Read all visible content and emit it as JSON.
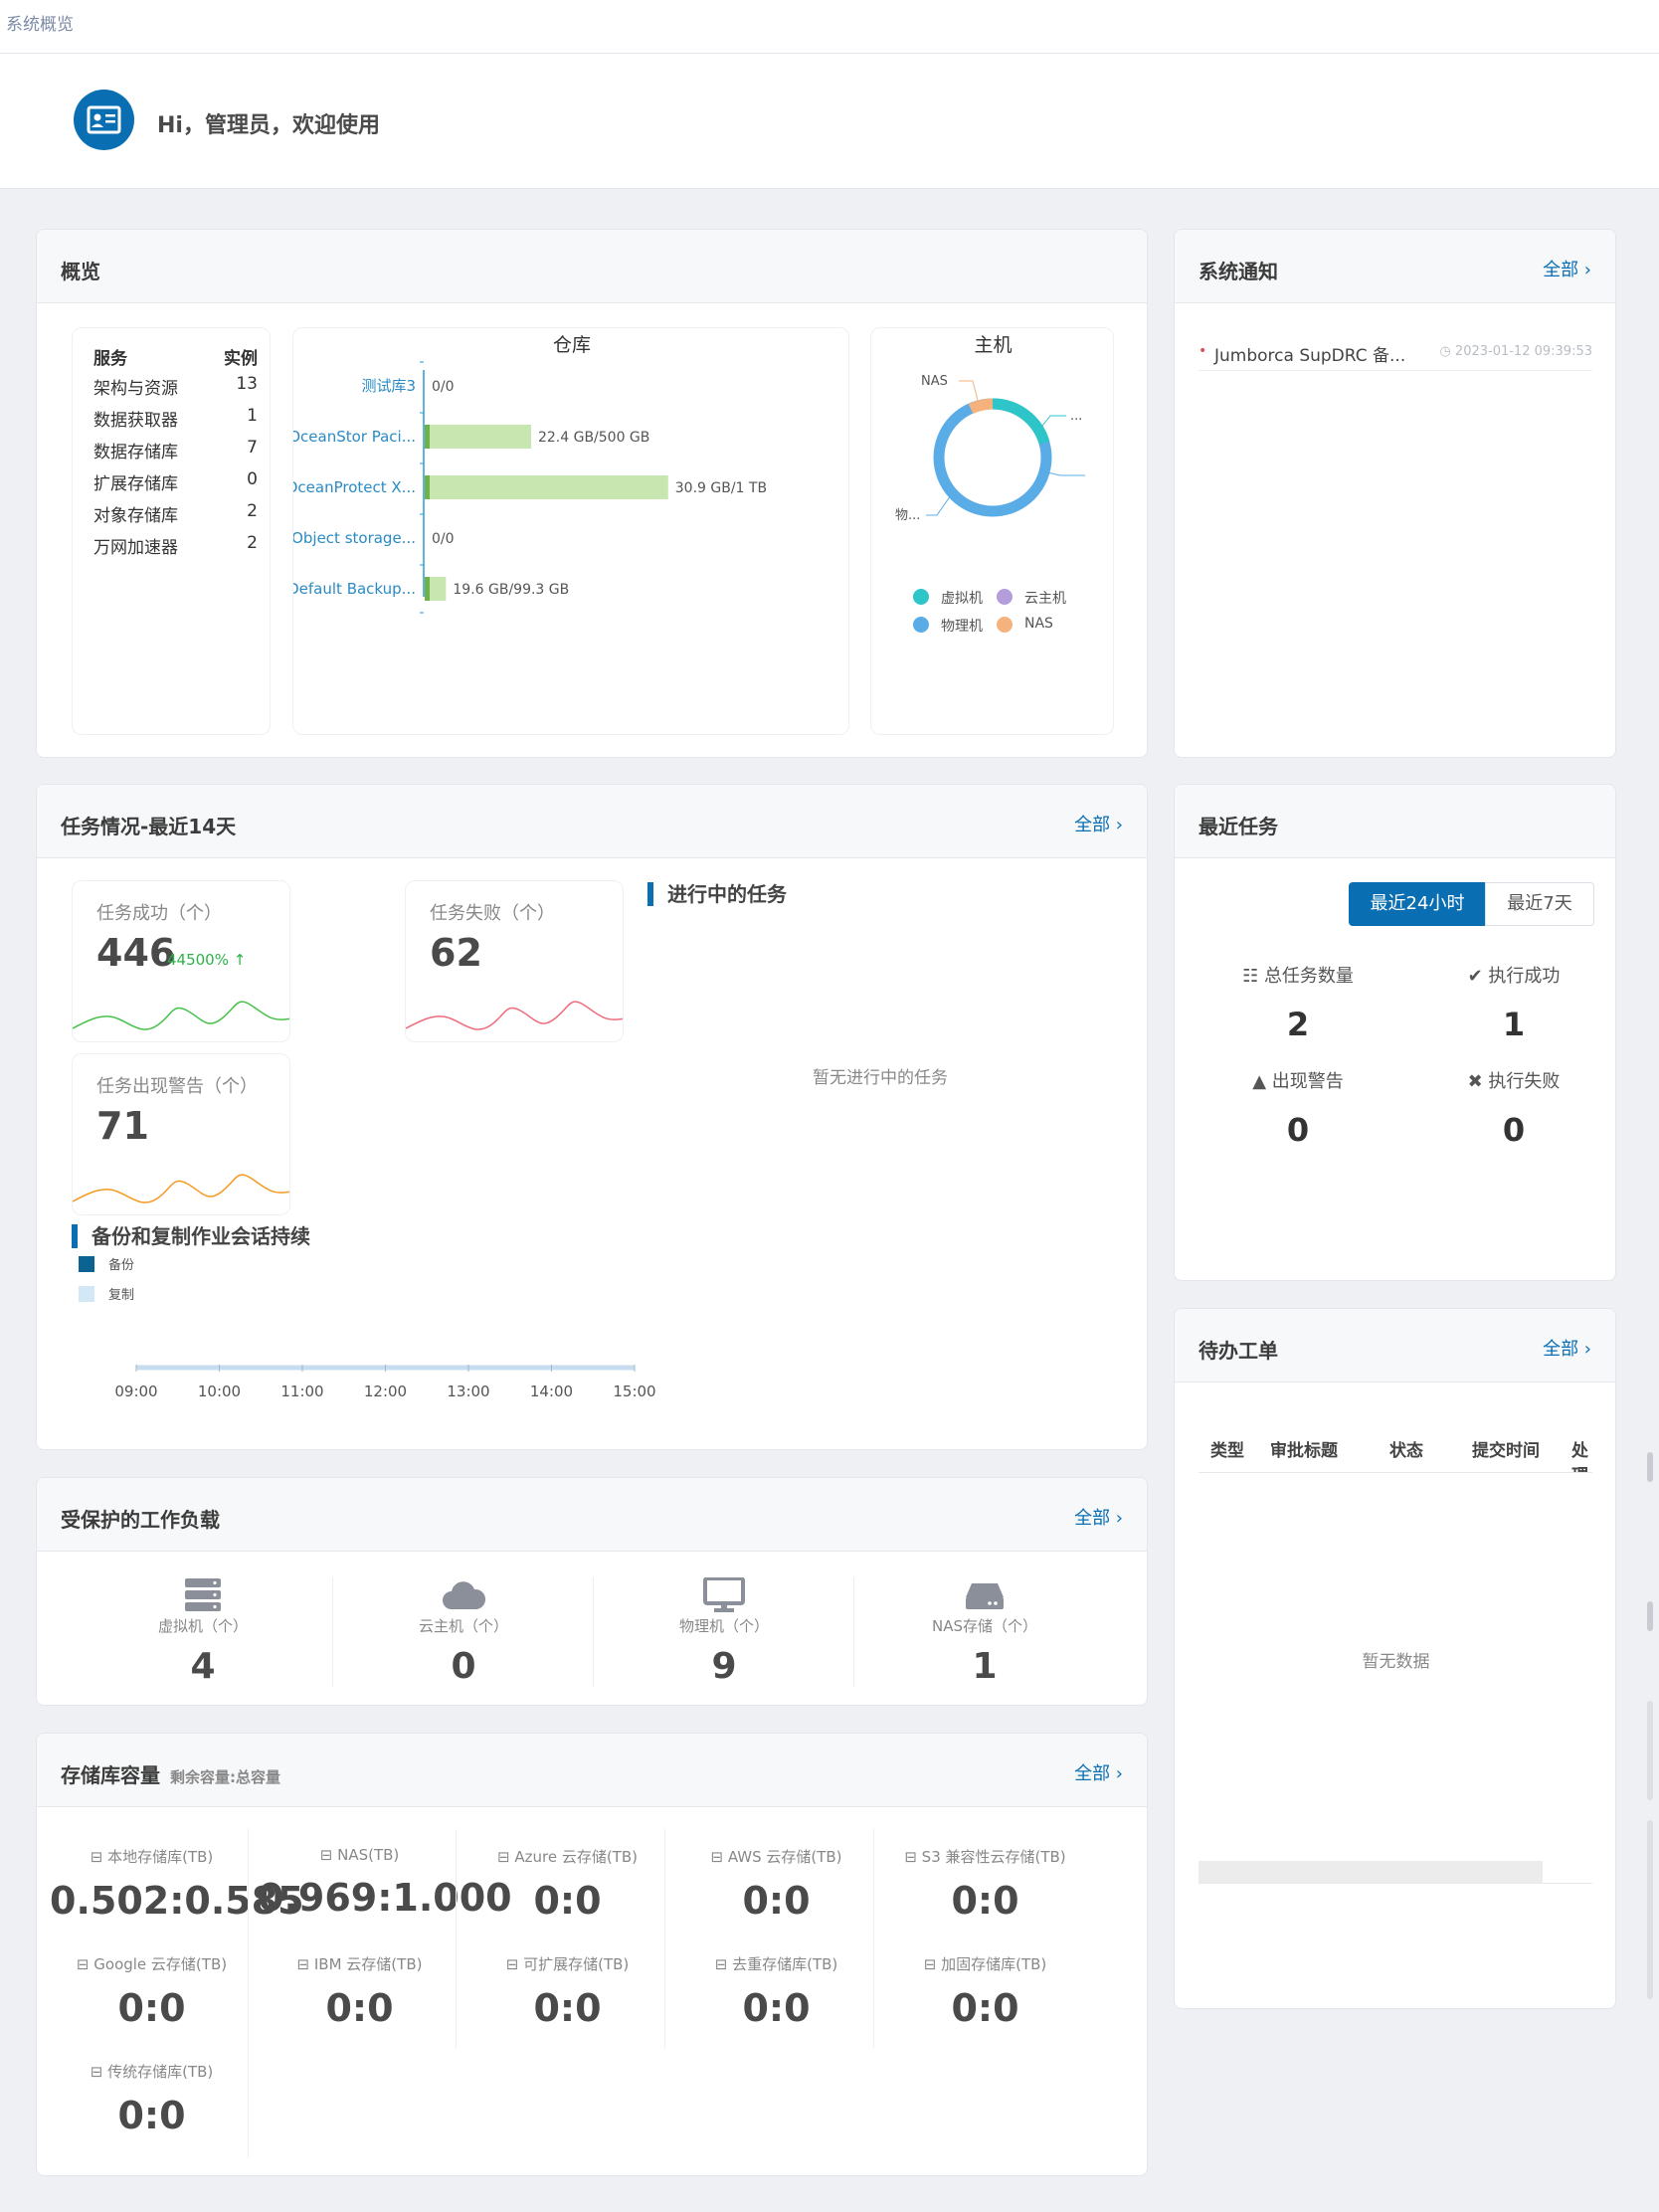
{
  "breadcrumb": "系统概览",
  "greeting": "Hi，管理员，欢迎使用",
  "overview": {
    "title": "概览",
    "services": {
      "col_service": "服务",
      "col_instance": "实例",
      "rows": [
        {
          "name": "架构与资源",
          "count": "13"
        },
        {
          "name": "数据获取器",
          "count": "1"
        },
        {
          "name": "数据存储库",
          "count": "7"
        },
        {
          "name": "扩展存储库",
          "count": "0"
        },
        {
          "name": "对象存储库",
          "count": "2"
        },
        {
          "name": "万网加速器",
          "count": "2"
        }
      ]
    },
    "warehouse": {
      "title": "仓库",
      "bars": [
        {
          "name": "测试库3",
          "label": "0/0",
          "used": 0,
          "total": 0
        },
        {
          "name": "OceanStor Paci...",
          "label": "22.4 GB/500 GB",
          "used": 22.4,
          "total": 500
        },
        {
          "name": "OceanProtect X...",
          "label": "30.9 GB/1 TB",
          "used": 30.9,
          "total": 1000
        },
        {
          "name": "Object storage...",
          "label": "0/0",
          "used": 0,
          "total": 0
        },
        {
          "name": "Default Backup...",
          "label": "19.6 GB/99.3 GB",
          "used": 19.6,
          "total": 99.3
        }
      ],
      "bar_color": "#c8e6b0",
      "used_color": "#6fb24a",
      "axis_color": "#2a9bd4"
    },
    "host": {
      "title": "主机",
      "donut_labels": {
        "nas": "NAS",
        "vm": "...",
        "phys": "物..."
      },
      "legend": [
        {
          "name": "虚拟机",
          "color": "#2dc5c8"
        },
        {
          "name": "云主机",
          "color": "#b39ddb"
        },
        {
          "name": "物理机",
          "color": "#5aace6"
        },
        {
          "name": "NAS",
          "color": "#f5b27c"
        }
      ]
    }
  },
  "notice": {
    "title": "系统通知",
    "more": "全部",
    "items": [
      {
        "text": "Jumborca SupDRC 备...",
        "time": "2023-01-12 09:39:53"
      }
    ]
  },
  "tasks": {
    "title": "任务情况-最近14天",
    "more": "全部",
    "success": {
      "label": "任务成功（个）",
      "value": "446",
      "pct": "44500%"
    },
    "fail": {
      "label": "任务失败（个）",
      "value": "62"
    },
    "warn": {
      "label": "任务出现警告（个）",
      "value": "71"
    },
    "running": {
      "title": "进行中的任务",
      "empty": "暂无进行中的任务"
    },
    "session": {
      "title": "备份和复制作业会话持续",
      "legend": [
        {
          "name": "备份",
          "color": "#0a6390"
        },
        {
          "name": "复制",
          "color": "#d3e8f7"
        }
      ],
      "x": [
        "09:00",
        "10:00",
        "11:00",
        "12:00",
        "13:00",
        "14:00",
        "15:00"
      ]
    },
    "colors": {
      "success": "#46c24a",
      "fail": "#f06b7c",
      "warn": "#f59a23"
    }
  },
  "recent": {
    "title": "最近任务",
    "tabs": [
      "最近24小时",
      "最近7天"
    ],
    "stats": [
      {
        "label": "总任务数量",
        "value": "2"
      },
      {
        "label": "执行成功",
        "value": "1"
      },
      {
        "label": "出现警告",
        "value": "0"
      },
      {
        "label": "执行失败",
        "value": "0"
      }
    ]
  },
  "todo": {
    "title": "待办工单",
    "more": "全部",
    "columns": [
      "类型",
      "审批标题",
      "状态",
      "提交时间",
      "处理"
    ],
    "empty": "暂无数据"
  },
  "workload": {
    "title": "受保护的工作负载",
    "more": "全部",
    "items": [
      {
        "label": "虚拟机（个）",
        "value": "4",
        "icon": "server-icon"
      },
      {
        "label": "云主机（个）",
        "value": "0",
        "icon": "cloud-icon"
      },
      {
        "label": "物理机（个）",
        "value": "9",
        "icon": "monitor-icon"
      },
      {
        "label": "NAS存储（个）",
        "value": "1",
        "icon": "nas-icon"
      }
    ]
  },
  "capacity": {
    "title": "存储库容量",
    "subtitle": "剩余容量:总容量",
    "more": "全部",
    "items": [
      {
        "label": "本地存储库(TB)",
        "value": "0.502:0.585"
      },
      {
        "label": "NAS(TB)",
        "value": "0.969:1.000"
      },
      {
        "label": "Azure 云存储(TB)",
        "value": "0:0"
      },
      {
        "label": "AWS 云存储(TB)",
        "value": "0:0"
      },
      {
        "label": "S3 兼容性云存储(TB)",
        "value": "0:0"
      },
      {
        "label": "Google 云存储(TB)",
        "value": "0:0"
      },
      {
        "label": "IBM 云存储(TB)",
        "value": "0:0"
      },
      {
        "label": "可扩展存储(TB)",
        "value": "0:0"
      },
      {
        "label": "去重存储库(TB)",
        "value": "0:0"
      },
      {
        "label": "加固存储库(TB)",
        "value": "0:0"
      },
      {
        "label": "传统存储库(TB)",
        "value": "0:0"
      }
    ]
  }
}
